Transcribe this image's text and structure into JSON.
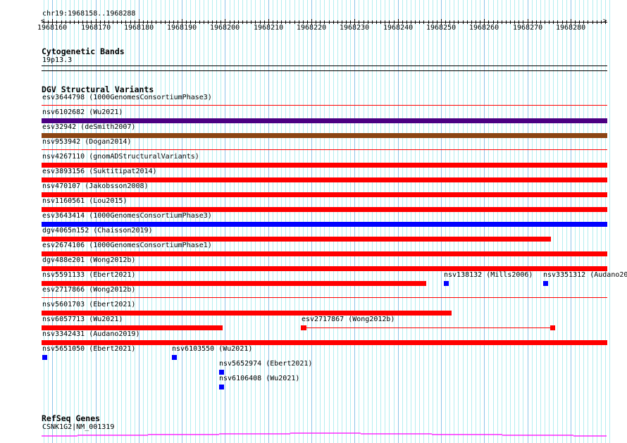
{
  "ruler": {
    "location": "chr19:1968158..1968288",
    "start": 1968158,
    "end": 1968288,
    "tick_labels": [
      "1968160",
      "1968170",
      "1968180",
      "1968190",
      "1968200",
      "1968210",
      "1968220",
      "1968230",
      "1968240",
      "1968250",
      "1968260",
      "1968270",
      "1968280"
    ]
  },
  "cytoband": {
    "title": "Cytogenetic Bands",
    "band": "19p13.3"
  },
  "dgv": {
    "title": "DGV Structural Variants",
    "colors": {
      "red": "#ff0000",
      "blue": "#0000ff",
      "purple": "#4b0082",
      "brown": "#8b4513"
    },
    "features": [
      {
        "row": 0,
        "label": "esv3644798 (1000GenomesConsortiumPhase3)",
        "start": 1968158,
        "end": 1968288,
        "color": "#ff0000",
        "style": "thin"
      },
      {
        "row": 1,
        "label": "nsv6102682 (Wu2021)",
        "start": 1968158,
        "end": 1968288,
        "color": "#4b0082",
        "style": "thick"
      },
      {
        "row": 2,
        "label": "esv32942 (deSmith2007)",
        "start": 1968158,
        "end": 1968288,
        "color": "#8b4513",
        "style": "thick"
      },
      {
        "row": 3,
        "label": "nsv953942 (Dogan2014)",
        "start": 1968158,
        "end": 1968288,
        "color": "#ff0000",
        "style": "thin"
      },
      {
        "row": 4,
        "label": "nsv4267110 (gnomADStructuralVariants)",
        "start": 1968158,
        "end": 1968288,
        "color": "#ff0000",
        "style": "thick"
      },
      {
        "row": 5,
        "label": "esv3893156 (Suktitipat2014)",
        "start": 1968158,
        "end": 1968288,
        "color": "#ff0000",
        "style": "thick"
      },
      {
        "row": 6,
        "label": "nsv470107 (Jakobsson2008)",
        "start": 1968158,
        "end": 1968288,
        "color": "#ff0000",
        "style": "thick"
      },
      {
        "row": 7,
        "label": "nsv1160561 (Lou2015)",
        "start": 1968158,
        "end": 1968288,
        "color": "#ff0000",
        "style": "thick"
      },
      {
        "row": 8,
        "label": "esv3643414 (1000GenomesConsortiumPhase3)",
        "start": 1968158,
        "end": 1968288,
        "color": "#0000ff",
        "style": "thick"
      },
      {
        "row": 9,
        "label": "dgv4065n152 (Chaisson2019)",
        "start": 1968158,
        "end": 1968275,
        "color": "#ff0000",
        "style": "thick"
      },
      {
        "row": 10,
        "label": "esv2674106 (1000GenomesConsortiumPhase1)",
        "start": 1968158,
        "end": 1968288,
        "color": "#ff0000",
        "style": "thick"
      },
      {
        "row": 11,
        "label": "dgv488e201 (Wong2012b)",
        "start": 1968158,
        "end": 1968288,
        "color": "#ff0000",
        "style": "thick"
      },
      {
        "row": 12,
        "label": "nsv5591133 (Ebert2021)",
        "start": 1968158,
        "end": 1968246,
        "color": "#ff0000",
        "style": "thick"
      },
      {
        "row": 12,
        "label": "nsv138132 (Mills2006)",
        "start": 1968251,
        "end": 1968251,
        "color": "#0000ff",
        "style": "box"
      },
      {
        "row": 12,
        "label": "nsv3351312 (Audano2019)",
        "start": 1968274,
        "end": 1968274,
        "color": "#0000ff",
        "style": "box"
      },
      {
        "row": 13,
        "label": "esv2717866 (Wong2012b)",
        "start": 1968158,
        "end": 1968288,
        "color": "#ff0000",
        "style": "thin"
      },
      {
        "row": 14,
        "label": "nsv5601703 (Ebert2021)",
        "start": 1968158,
        "end": 1968252,
        "color": "#ff0000",
        "style": "thick"
      },
      {
        "row": 15,
        "label": "nsv6057713 (Wu2021)",
        "start": 1968158,
        "end": 1968199,
        "color": "#ff0000",
        "style": "thick"
      },
      {
        "row": 15,
        "label": "esv2717867 (Wong2012b)",
        "start": 1968218,
        "end": 1968276,
        "color": "#ff0000",
        "style": "ends"
      },
      {
        "row": 16,
        "label": "nsv3342431 (Audano2019)",
        "start": 1968158,
        "end": 1968288,
        "color": "#ff0000",
        "style": "thick"
      },
      {
        "row": 17,
        "label": "nsv5651050 (Ebert2021)",
        "start": 1968158,
        "end": 1968158,
        "color": "#0000ff",
        "style": "box"
      },
      {
        "row": 17,
        "label": "nsv6103550 (Wu2021)",
        "start": 1968188,
        "end": 1968188,
        "color": "#0000ff",
        "style": "box"
      },
      {
        "row": 18,
        "label": "nsv5652974 (Ebert2021)",
        "start": 1968199,
        "end": 1968199,
        "color": "#0000ff",
        "style": "box"
      },
      {
        "row": 19,
        "label": "nsv6106408 (Wu2021)",
        "start": 1968199,
        "end": 1968199,
        "color": "#0000ff",
        "style": "box"
      }
    ]
  },
  "refseq": {
    "title": "RefSeq Genes",
    "gene": "CSNK1G2|NM_001319",
    "color": "#ff00ff"
  }
}
